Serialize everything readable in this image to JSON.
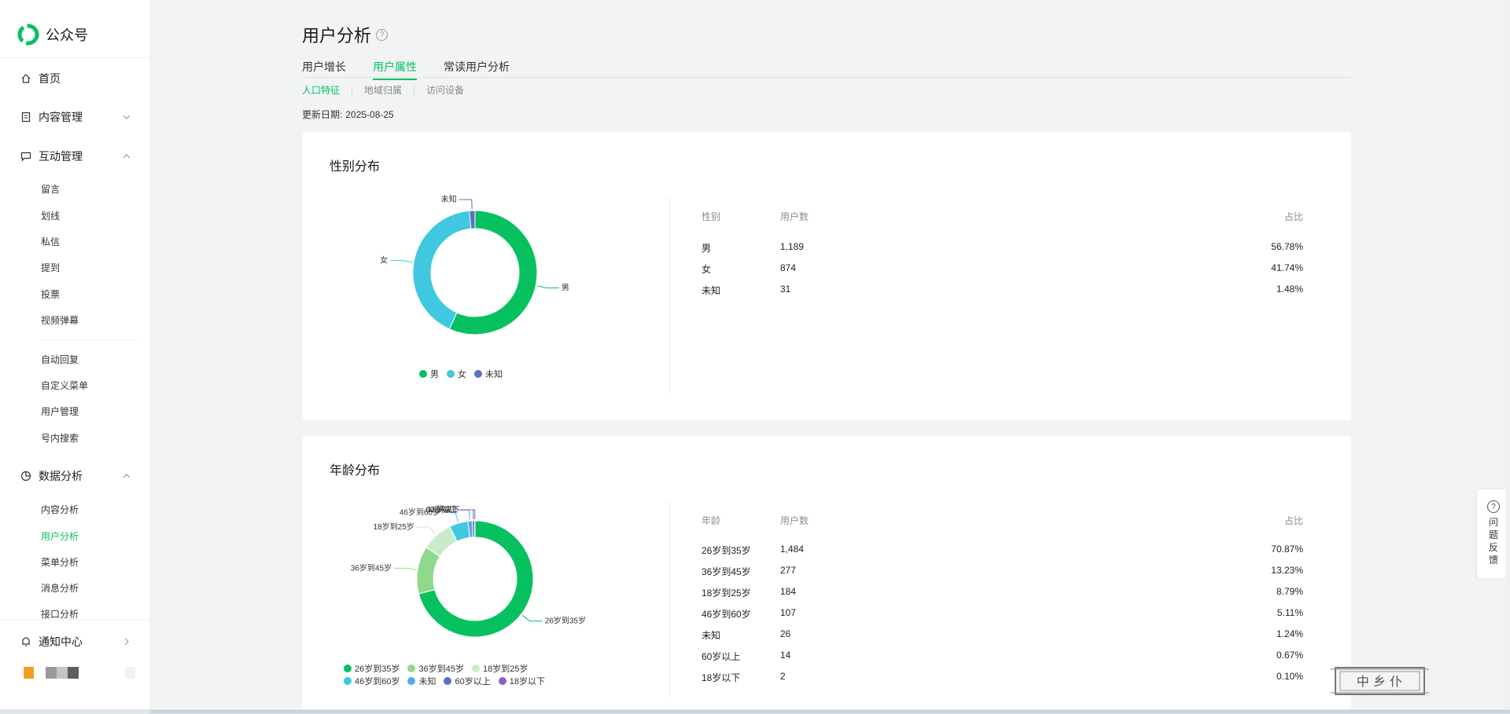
{
  "sidebar": {
    "brand": "公众号",
    "home": "首页",
    "content_mgmt": "内容管理",
    "interaction_mgmt": "互动管理",
    "interaction_items": [
      "留言",
      "划线",
      "私信",
      "提到",
      "投票",
      "视频弹幕"
    ],
    "tool_items": [
      "自动回复",
      "自定义菜单",
      "用户管理",
      "号内搜索"
    ],
    "data_analysis": "数据分析",
    "data_items": [
      "内容分析",
      "用户分析",
      "菜单分析",
      "消息分析",
      "接口分析"
    ],
    "active_item": "用户分析",
    "notifications": "通知中心"
  },
  "page": {
    "title": "用户分析",
    "help_glyph": "?",
    "tabs": [
      "用户增长",
      "用户属性",
      "常读用户分析"
    ],
    "active_tab": "用户属性",
    "subtabs": [
      "人口特征",
      "地域归属",
      "访问设备"
    ],
    "active_subtab": "人口特征",
    "update_label": "更新日期:",
    "update_date": "2025-08-25"
  },
  "gender": {
    "title": "性别分布",
    "headers": [
      "性别",
      "用户数",
      "占比"
    ],
    "rows": [
      {
        "label": "男",
        "count": "1,189",
        "pct": "56.78%"
      },
      {
        "label": "女",
        "count": "874",
        "pct": "41.74%"
      },
      {
        "label": "未知",
        "count": "31",
        "pct": "1.48%"
      }
    ]
  },
  "age": {
    "title": "年龄分布",
    "headers": [
      "年龄",
      "用户数",
      "占比"
    ],
    "rows": [
      {
        "label": "26岁到35岁",
        "count": "1,484",
        "pct": "70.87%"
      },
      {
        "label": "36岁到45岁",
        "count": "277",
        "pct": "13.23%"
      },
      {
        "label": "18岁到25岁",
        "count": "184",
        "pct": "8.79%"
      },
      {
        "label": "46岁到60岁",
        "count": "107",
        "pct": "5.11%"
      },
      {
        "label": "未知",
        "count": "26",
        "pct": "1.24%"
      },
      {
        "label": "60岁以上",
        "count": "14",
        "pct": "0.67%"
      },
      {
        "label": "18岁以下",
        "count": "2",
        "pct": "0.10%"
      }
    ]
  },
  "chart_data": [
    {
      "type": "pie",
      "title": "性别分布",
      "categories": [
        "男",
        "女",
        "未知"
      ],
      "values": [
        1189,
        874,
        31
      ],
      "colors": [
        "#07c160",
        "#3fc8e0",
        "#5b6fc6"
      ],
      "legend": "bottom"
    },
    {
      "type": "pie",
      "title": "年龄分布",
      "categories": [
        "26岁到35岁",
        "36岁到45岁",
        "18岁到25岁",
        "46岁到60岁",
        "未知",
        "60岁以上",
        "18岁以下"
      ],
      "values": [
        1484,
        277,
        184,
        107,
        26,
        14,
        2
      ],
      "colors": [
        "#07c160",
        "#8fd88c",
        "#c8ecc9",
        "#3fc8e0",
        "#56a9ea",
        "#5b6fc6",
        "#8e5fc4"
      ],
      "legend": "bottom"
    }
  ],
  "feedback": {
    "glyph": "?",
    "text": "问题反馈"
  },
  "stamp": {
    "text": "中 乡 仆"
  }
}
